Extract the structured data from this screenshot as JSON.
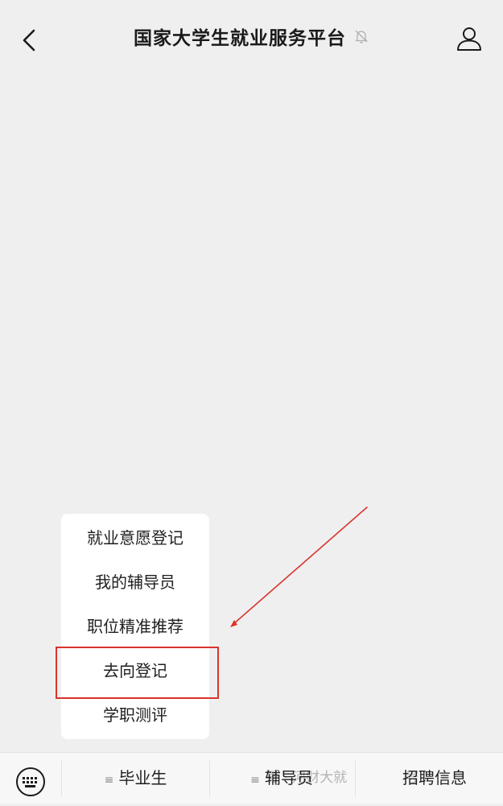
{
  "header": {
    "title": "国家大学生就业服务平台"
  },
  "popup_menu": {
    "items": [
      {
        "label": "就业意愿登记"
      },
      {
        "label": "我的辅导员"
      },
      {
        "label": "职位精准推荐"
      },
      {
        "label": "去向登记",
        "highlighted": true
      },
      {
        "label": "学职测评"
      }
    ]
  },
  "bottom_menu": {
    "items": [
      {
        "label": "毕业生"
      },
      {
        "label": "辅导员"
      },
      {
        "label": "招聘信息"
      }
    ],
    "watermark": "号 · 河财大就",
    "watermark_tail": "号"
  },
  "colors": {
    "annotation": "#d9342b",
    "background": "#efeff0",
    "menu_bg": "#ffffff"
  }
}
